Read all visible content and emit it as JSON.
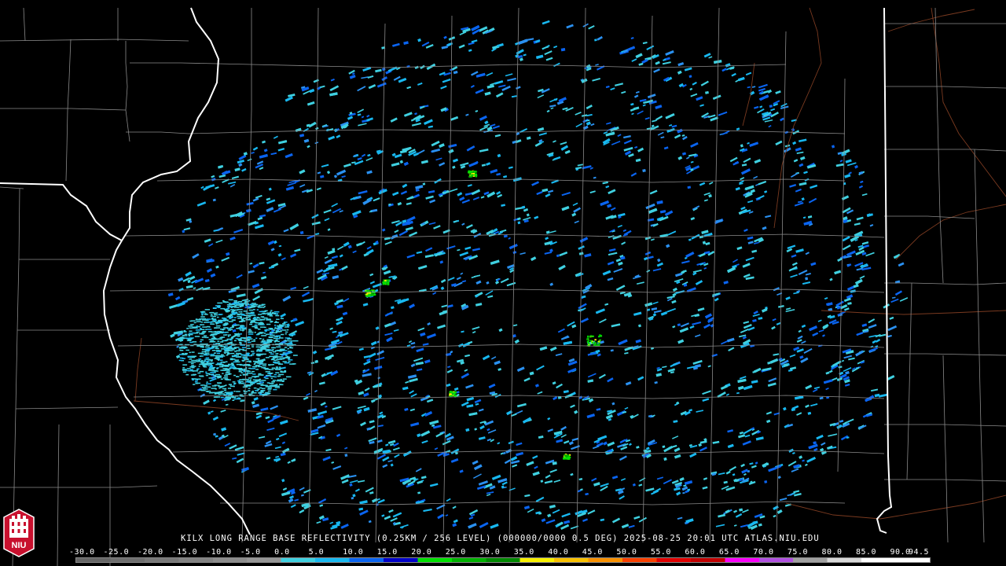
{
  "product": {
    "caption": "KILX LONG RANGE BASE REFLECTIVITY (0.25KM / 256 LEVEL) (000000/0000 0.5 DEG) 2025-08-25 20:01 UTC  ATLAS.NIU.EDU"
  },
  "logo": {
    "text": "NIU"
  },
  "legend": {
    "labels": [
      "-30.0",
      "-25.0",
      "-20.0",
      "-15.0",
      "-10.0",
      "-5.0",
      "0.0",
      "5.0",
      "10.0",
      "15.0",
      "20.0",
      "25.0",
      "30.0",
      "35.0",
      "40.0",
      "45.0",
      "50.0",
      "55.0",
      "60.0",
      "65.0",
      "70.0",
      "75.0",
      "80.0",
      "85.0",
      "90.0",
      "94.5"
    ],
    "colors": [
      "#666666",
      "#6e6e6e",
      "#787878",
      "#828282",
      "#8c8c8c",
      "#969696",
      "#3fd0e0",
      "#18b8f0",
      "#0a64f0",
      "#0000c8",
      "#00e000",
      "#00b000",
      "#008800",
      "#f8f000",
      "#f8c000",
      "#f89000",
      "#f84000",
      "#e00000",
      "#c00000",
      "#f800f8",
      "#b050e0",
      "#a0a0a0",
      "#d8d8d8",
      "#ffffff",
      "#ffffff"
    ]
  }
}
